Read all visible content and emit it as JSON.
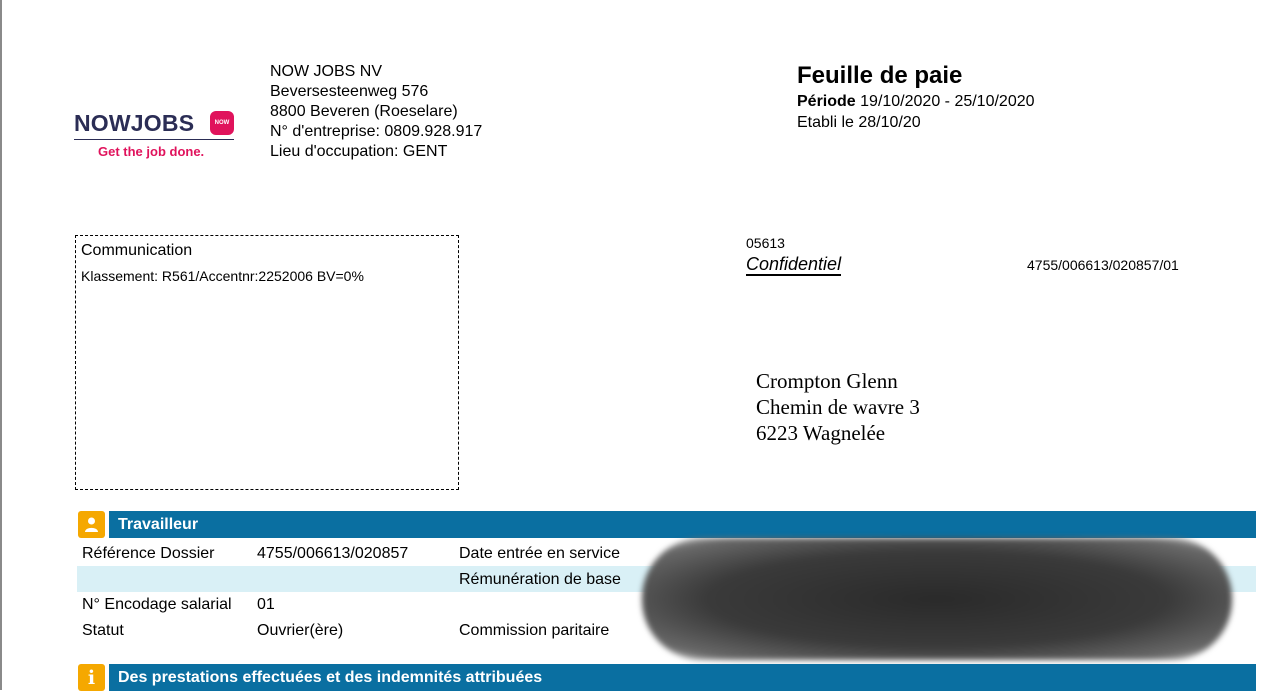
{
  "logo": {
    "wordmark": "NOWJOBS",
    "badge": "NOW",
    "tagline": "Get the job done."
  },
  "company": {
    "name": "NOW JOBS NV",
    "street": "Beversesteenweg 576",
    "city": "8800 Beveren (Roeselare)",
    "enterprise": "N° d'entreprise: 0809.928.917",
    "location": "Lieu d'occupation: GENT"
  },
  "header": {
    "title": "Feuille de paie",
    "periode_label": "Période",
    "periode_value": "19/10/2020 - 25/10/2020",
    "etabli": "Etabli le 28/10/20"
  },
  "communication": {
    "title": "Communication",
    "text": "Klassement: R561/Accentnr:2252006 BV=0%"
  },
  "recipient_block": {
    "code": "05613",
    "confidential": "Confidentiel",
    "reference": "4755/006613/020857/01"
  },
  "address": {
    "name": "Crompton Glenn",
    "street": "Chemin de wavre 3",
    "city": "6223 Wagnelée"
  },
  "sections": {
    "worker": {
      "title": "Travailleur",
      "ref_label": "Référence Dossier",
      "ref_value": "4755/006613/020857",
      "date_label": "Date entrée en service",
      "remuneration_label": "Rémunération de base",
      "encodage_label": "N° Encodage salarial",
      "encodage_value": "01",
      "statut_label": "Statut",
      "statut_value": "Ouvrier(ère)",
      "commission_label": "Commission paritaire"
    },
    "services": {
      "title": "Des prestations effectuées et des indemnités attribuées"
    }
  },
  "colors": {
    "section_blue": "#0a6fa1",
    "icon_orange": "#f5a800",
    "stripe": "#d9f0f6",
    "brand_navy": "#2b2d55",
    "brand_pink": "#e0135c"
  }
}
